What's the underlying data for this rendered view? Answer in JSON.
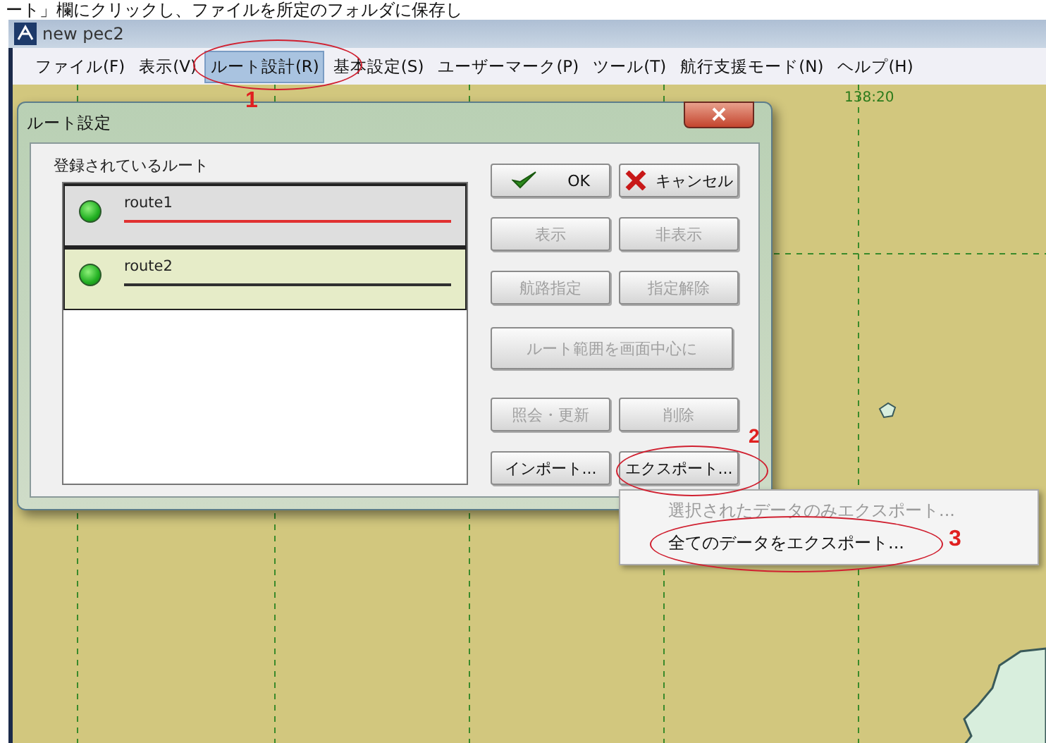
{
  "caption": "ート」欄にクリックし、ファイルを所定のフォルダに保存し",
  "window": {
    "title": "new pec2"
  },
  "menu": [
    {
      "label": "ファイル(F)",
      "selected": false
    },
    {
      "label": "表示(V)",
      "selected": false
    },
    {
      "label": "ルート設計(R)",
      "selected": true
    },
    {
      "label": "基本設定(S)",
      "selected": false
    },
    {
      "label": "ユーザーマーク(P)",
      "selected": false
    },
    {
      "label": "ツール(T)",
      "selected": false
    },
    {
      "label": "航行支援モード(N)",
      "selected": false
    },
    {
      "label": "ヘルプ(H)",
      "selected": false
    }
  ],
  "map": {
    "labels": [
      "138:20"
    ]
  },
  "dialog": {
    "title": "ルート設定",
    "group_title": "登録されているルート",
    "routes": [
      {
        "name": "route1",
        "selected": true,
        "color": "#e03030"
      },
      {
        "name": "route2",
        "selected": false,
        "color": "#303030"
      }
    ],
    "buttons": [
      {
        "label": "OK",
        "kind": "ok",
        "disabled": false
      },
      {
        "label": "キャンセル",
        "kind": "cancel",
        "disabled": false
      },
      {
        "label": "表示",
        "kind": "plain",
        "disabled": true
      },
      {
        "label": "非表示",
        "kind": "plain",
        "disabled": true
      },
      {
        "label": "航路指定",
        "kind": "plain",
        "disabled": true
      },
      {
        "label": "指定解除",
        "kind": "plain",
        "disabled": true
      },
      {
        "label": "ルート範囲を画面中心に",
        "kind": "wide",
        "disabled": true
      },
      {
        "label": "照会・更新",
        "kind": "plain",
        "disabled": true
      },
      {
        "label": "削除",
        "kind": "plain",
        "disabled": true
      },
      {
        "label": "インポート...",
        "kind": "plain",
        "disabled": false
      },
      {
        "label": "エクスポート...",
        "kind": "plain",
        "disabled": false
      }
    ]
  },
  "context_menu": [
    {
      "label": "選択されたデータのみエクスポート...",
      "disabled": true
    },
    {
      "label": "全てのデータをエクスポート...",
      "disabled": false
    }
  ],
  "annotations": [
    "1",
    "2",
    "3"
  ]
}
